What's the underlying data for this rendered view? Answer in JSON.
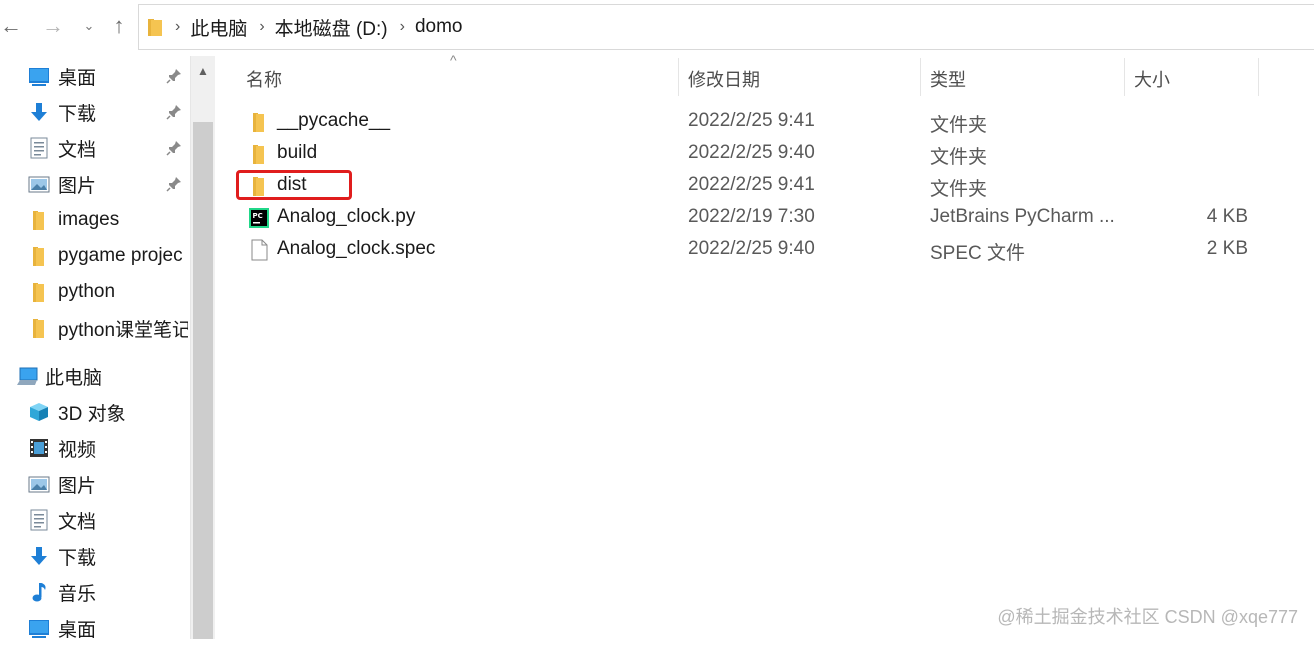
{
  "nav": {
    "back_glyph": "←",
    "forward_glyph": "→",
    "recent_glyph": "⌄",
    "up_glyph": "↑"
  },
  "breadcrumb": [
    "此电脑",
    "本地磁盘 (D:)",
    "domo"
  ],
  "sidebar": {
    "quick_access": [
      {
        "label": "桌面",
        "icon": "desktop-icon",
        "pinned": true
      },
      {
        "label": "下载",
        "icon": "download-icon",
        "pinned": true
      },
      {
        "label": "文档",
        "icon": "document-icon",
        "pinned": true
      },
      {
        "label": "图片",
        "icon": "pictures-icon",
        "pinned": true
      },
      {
        "label": "images",
        "icon": "folder-icon",
        "pinned": false
      },
      {
        "label": "pygame projec",
        "icon": "folder-icon",
        "pinned": false
      },
      {
        "label": "python",
        "icon": "folder-icon",
        "pinned": false
      },
      {
        "label": "python课堂笔记",
        "icon": "folder-icon",
        "pinned": false
      }
    ],
    "this_pc": {
      "label": "此电脑",
      "icon": "computer-icon"
    },
    "this_pc_items": [
      {
        "label": "3D 对象",
        "icon": "3d-objects-icon"
      },
      {
        "label": "视频",
        "icon": "videos-icon"
      },
      {
        "label": "图片",
        "icon": "pictures-icon"
      },
      {
        "label": "文档",
        "icon": "document-icon"
      },
      {
        "label": "下载",
        "icon": "download-icon"
      },
      {
        "label": "音乐",
        "icon": "music-icon"
      },
      {
        "label": "桌面",
        "icon": "desktop-icon"
      }
    ]
  },
  "columns": {
    "name": "名称",
    "date": "修改日期",
    "type": "类型",
    "size": "大小"
  },
  "files": [
    {
      "name": "__pycache__",
      "date": "2022/2/25 9:41",
      "type": "文件夹",
      "size": "",
      "icon": "folder-icon"
    },
    {
      "name": "build",
      "date": "2022/2/25 9:40",
      "type": "文件夹",
      "size": "",
      "icon": "folder-icon"
    },
    {
      "name": "dist",
      "date": "2022/2/25 9:41",
      "type": "文件夹",
      "size": "",
      "icon": "folder-icon"
    },
    {
      "name": "Analog_clock.py",
      "date": "2022/2/19 7:30",
      "type": "JetBrains PyCharm ...",
      "size": "4 KB",
      "icon": "pycharm-file-icon"
    },
    {
      "name": "Analog_clock.spec",
      "date": "2022/2/25 9:40",
      "type": "SPEC 文件",
      "size": "2 KB",
      "icon": "blank-file-icon"
    }
  ],
  "watermark": "@稀土掘金技术社区 CSDN @xqe777",
  "colors": {
    "folder": "#f5c451",
    "highlight": "#e01d1d",
    "accent": "#0a64c8"
  }
}
